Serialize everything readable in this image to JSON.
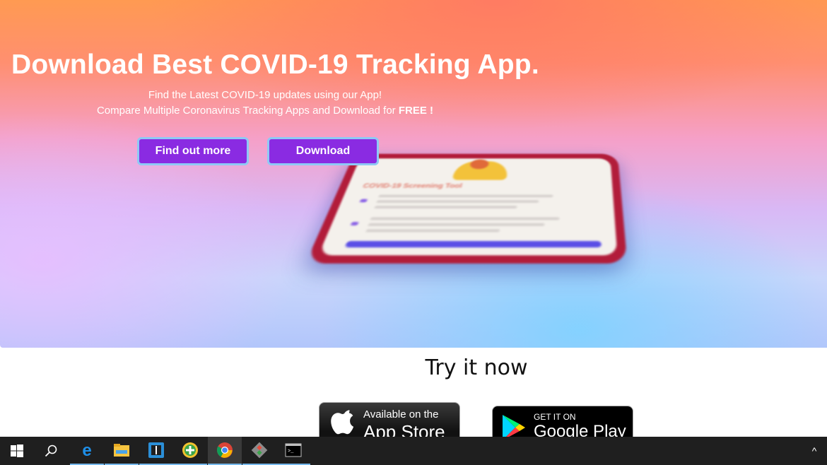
{
  "hero": {
    "title": "Download Best COVID-19 Tracking App.",
    "subtitle_line1": "Find the Latest COVID-19 updates using our App!",
    "subtitle_line2_text": "Compare Multiple Coronavirus Tracking Apps and Download for ",
    "subtitle_line2_bold": "FREE !",
    "find_out_more_label": "Find out more",
    "download_label": "Download",
    "phone_heading": "COVID-19 Screening Tool"
  },
  "try_section": {
    "title": "Try it now",
    "app_store": {
      "small": "Available on the",
      "big": "App Store",
      "icon": "apple-icon"
    },
    "google_play": {
      "small": "GET IT ON",
      "big": "Google Play",
      "icon": "google-play-icon"
    }
  },
  "taskbar": {
    "items": [
      {
        "name": "start-icon"
      },
      {
        "name": "search-icon"
      },
      {
        "name": "edge-icon",
        "running": true
      },
      {
        "name": "file-explorer-icon",
        "running": true
      },
      {
        "name": "editor-icon",
        "running": true
      },
      {
        "name": "green-plus-app-icon",
        "running": true
      },
      {
        "name": "chrome-icon",
        "running": true,
        "active": true
      },
      {
        "name": "git-icon",
        "running": true
      },
      {
        "name": "terminal-icon",
        "running": true
      }
    ],
    "tray_chevron": "^"
  },
  "colors": {
    "button_bg": "#8a2be2",
    "button_border": "#8ec9f5",
    "taskbar_bg": "#1f1f1f",
    "running_indicator": "#76b9ed"
  }
}
